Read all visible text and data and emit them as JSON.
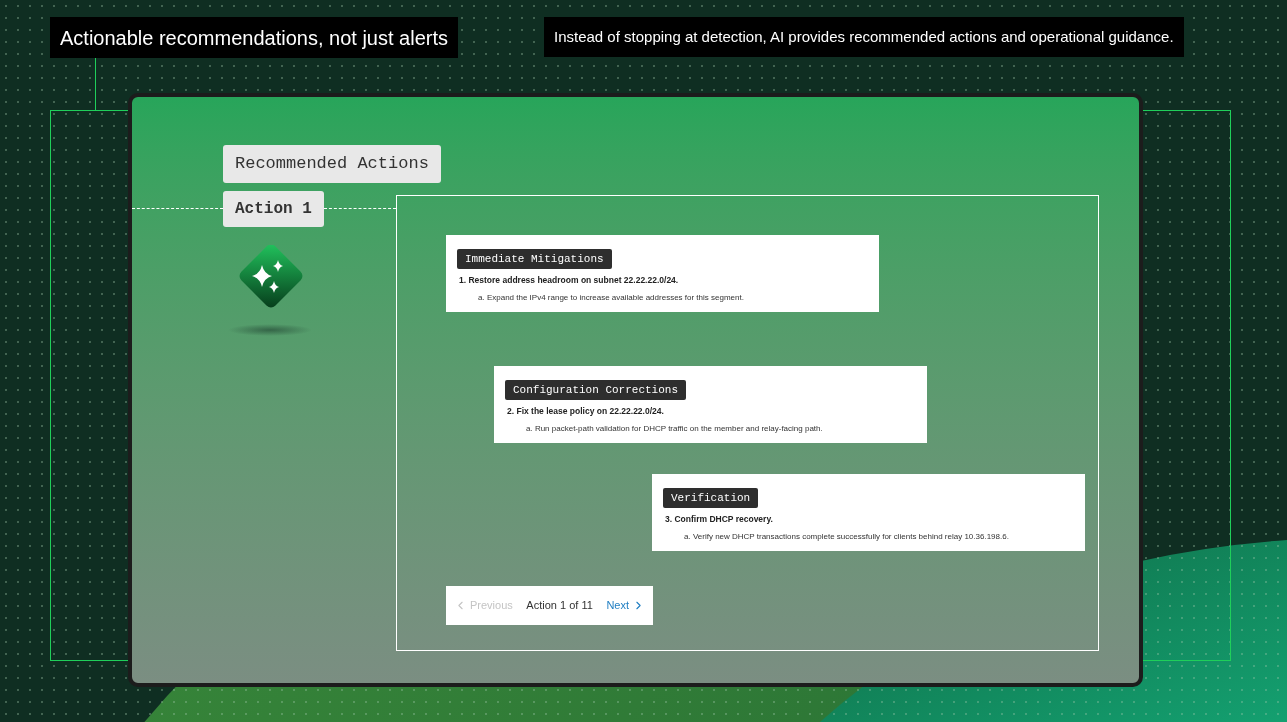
{
  "callouts": [
    {
      "text": "Actionable recommendations, not just alerts",
      "kind": "headline"
    },
    {
      "text": "Instead of stopping at detection, AI provides recommended actions and operational guidance.",
      "kind": "note"
    }
  ],
  "panel": {
    "heading": "Recommended Actions",
    "action_label": "Action 1"
  },
  "steps": [
    {
      "category": "Immediate Mitigations",
      "title": "1. Restore address headroom on subnet 22.22.22.0/24.",
      "detail": "a. Expand the IPv4 range to increase available addresses for this segment."
    },
    {
      "category": "Configuration Corrections",
      "title": "2. Fix the lease policy on 22.22.22.0/24.",
      "detail": "a. Run packet-path validation for DHCP traffic on the member and relay-facing path."
    },
    {
      "category": "Verification",
      "title": "3. Confirm DHCP recovery.",
      "detail": "a. Verify new DHCP transactions complete successfully for clients behind relay 10.36.198.6."
    }
  ],
  "pagination": {
    "previous": {
      "label": "Previous",
      "disabled": true
    },
    "status": "Action 1 of 11",
    "next": {
      "label": "Next",
      "disabled": false
    }
  }
}
